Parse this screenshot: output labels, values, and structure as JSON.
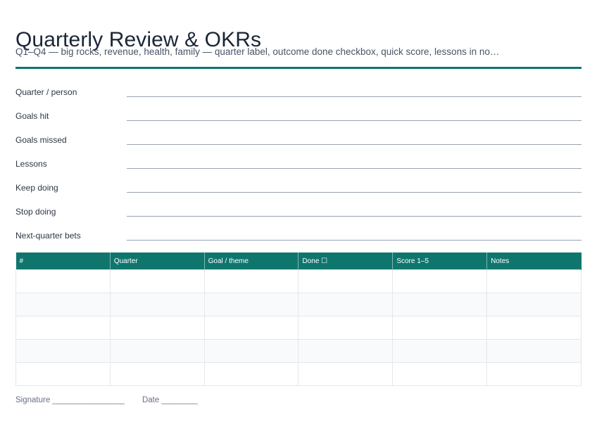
{
  "title": "Quarterly Review & OKRs",
  "subtitle": "Q1–Q4 — big rocks, revenue, health, family — quarter label, outcome done checkbox, quick score, lessons in no…",
  "fields": [
    {
      "label": "Quarter / person",
      "value": ""
    },
    {
      "label": "Goals hit",
      "value": ""
    },
    {
      "label": "Goals missed",
      "value": ""
    },
    {
      "label": "Lessons",
      "value": ""
    },
    {
      "label": "Keep doing",
      "value": ""
    },
    {
      "label": "Stop doing",
      "value": ""
    },
    {
      "label": "Next-quarter  bets",
      "value": ""
    }
  ],
  "table": {
    "columns": [
      "#",
      "Quarter",
      "Goal / theme",
      "Done ☐",
      "Score 1–5",
      "Notes"
    ],
    "rows": [
      [
        "",
        "",
        "",
        "",
        "",
        ""
      ],
      [
        "",
        "",
        "",
        "",
        "",
        ""
      ],
      [
        "",
        "",
        "",
        "",
        "",
        ""
      ],
      [
        "",
        "",
        "",
        "",
        "",
        ""
      ],
      [
        "",
        "",
        "",
        "",
        "",
        ""
      ]
    ]
  },
  "footer": {
    "signature": "Signature ________________",
    "date": "Date ________"
  },
  "colors": {
    "accent": "#0f766e"
  }
}
